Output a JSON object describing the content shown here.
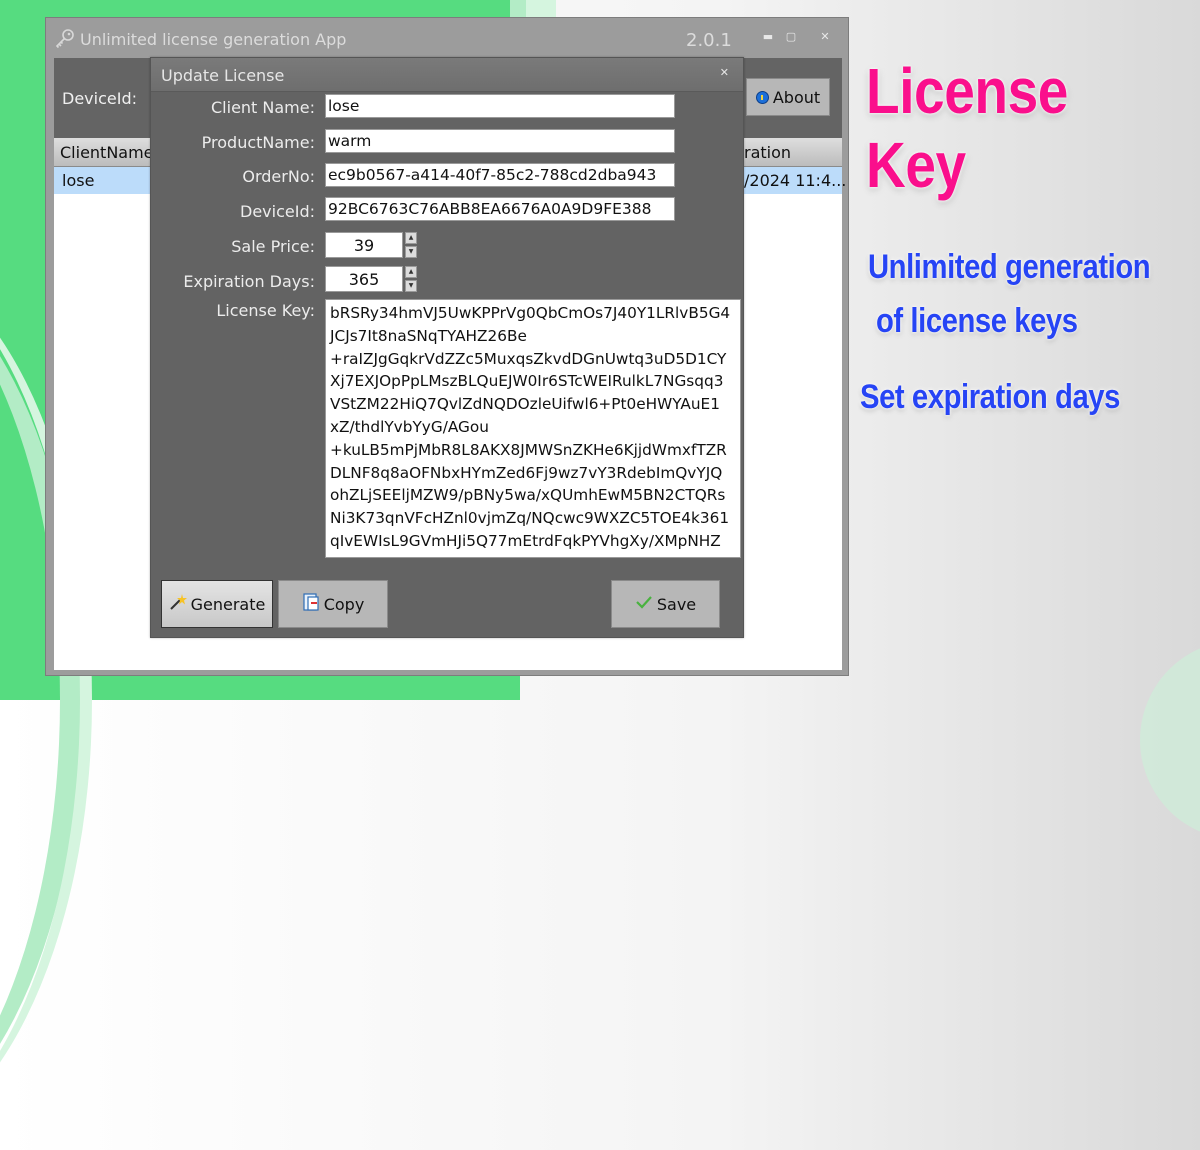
{
  "window": {
    "title": "Unlimited license generation App",
    "version": "2.0.1",
    "controls": {
      "minimize": "▬",
      "maximize": "▢",
      "close": "✕"
    }
  },
  "toolbar": {
    "deviceid_label": "DeviceId:",
    "about_label": "About"
  },
  "grid": {
    "columns": [
      "ClientName",
      "ration"
    ],
    "rows": [
      {
        "client_name": "lose",
        "expiration": "/2024 11:4..."
      }
    ]
  },
  "dialog": {
    "title": "Update License",
    "close": "✕",
    "fields": {
      "client_name": {
        "label": "Client Name:",
        "value": "lose"
      },
      "product_name": {
        "label": "ProductName:",
        "value": "warm"
      },
      "order_no": {
        "label": "OrderNo:",
        "value": "ec9b0567-a414-40f7-85c2-788cd2dba943"
      },
      "device_id": {
        "label": "DeviceId:",
        "value": "92BC6763C76ABB8EA6676A0A9D9FE388"
      },
      "sale_price": {
        "label": "Sale Price:",
        "value": "39"
      },
      "expiration_days": {
        "label": "Expiration Days:",
        "value": "365"
      },
      "license_key": {
        "label": "License Key:",
        "value": "bRSRy34hmVJ5UwKPPrVg0QbCmOs7J40Y1LRlvB5G4\nJCJs7It8naSNqTYAHZ26Be\n+raIZJgGqkrVdZZc5MuxqsZkvdDGnUwtq3uD5D1CY\nXj7EXJOpPpLMszBLQuEJW0Ir6STcWEIRulkL7NGsqq3\nVStZM22HiQ7QvlZdNQDOzleUifwl6+Pt0eHWYAuE1\nxZ/thdlYvbYyG/AGou\n+kuLB5mPjMbR8L8AKX8JMWSnZKHe6KjjdWmxfTZR\nDLNF8q8aOFNbxHYmZed6Fj9wz7vY3RdebImQvYJQ\nohZLjSEEljMZW9/pBNy5wa/xQUmhEwM5BN2CTQRs\nNi3K73qnVFcHZnl0vjmZq/NQcwc9WXZC5TOE4k361\nqIvEWIsL9GVmHJi5Q77mEtrdFqkPYVhgXy/XMpNHZ"
      }
    },
    "buttons": {
      "generate": "Generate",
      "copy": "Copy",
      "save": "Save"
    }
  },
  "promo": {
    "title": "License Key",
    "line1": "Unlimited generation",
    "line2": "of license keys",
    "line3": "Set expiration days",
    "title_color": "#fa0f8c",
    "line_color": "#2644f5"
  },
  "colors": {
    "background_green": "#56dc80",
    "selected_row": "#bcdcfa",
    "dialog_bg": "#636363"
  }
}
